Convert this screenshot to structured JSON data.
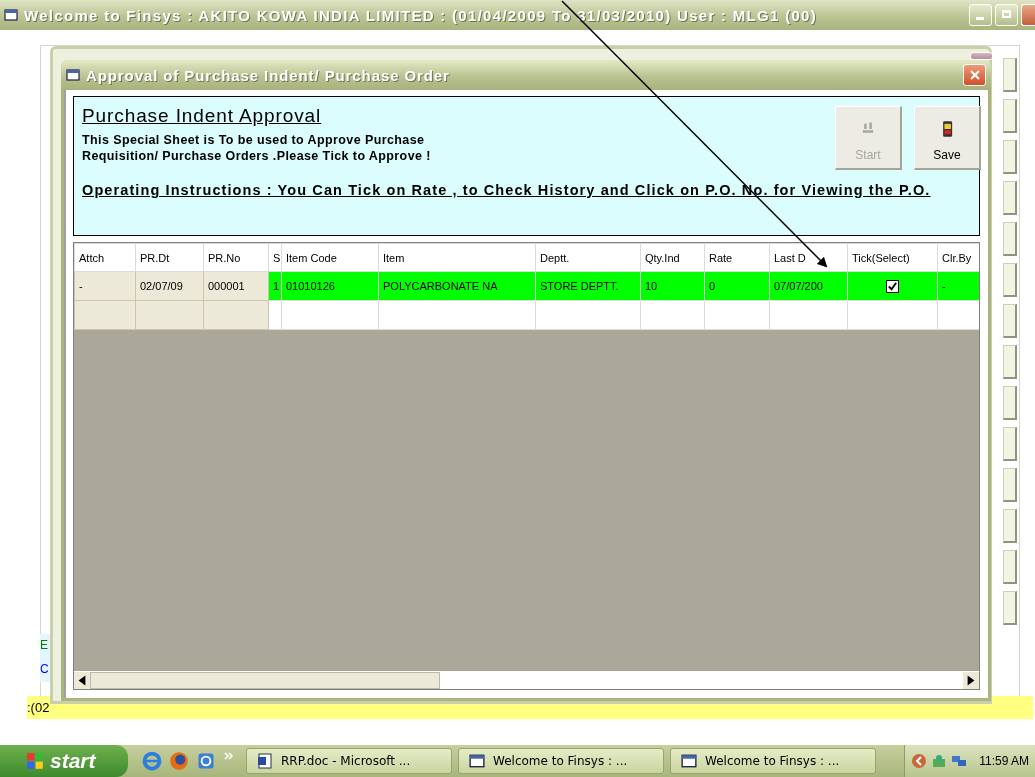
{
  "main_window": {
    "title": "Welcome to Finsys : AKITO KOWA INDIA LIMITED : (01/04/2009 To 31/03/2010) User : MLG1 (00)"
  },
  "background_form": {
    "labels": [
      {
        "text": "E",
        "color": "#008000"
      },
      {
        "text": "C",
        "color": "#0000ff"
      }
    ],
    "status": ":(02"
  },
  "dialog": {
    "title": "Approval of Purchase Indent/ Purchase Order",
    "heading": "Purchase Indent Approval",
    "description": "This Special Sheet is To be used to Approve Purchase Requisition/ Purchase Orders .Please Tick to Approve !",
    "instructions": "Operating Instructions : You Can Tick on Rate , to Check History  and Click on P.O. No. for Viewing the P.O.",
    "toolbar": [
      {
        "kind": "start",
        "label": "Start",
        "disabled": true
      },
      {
        "kind": "save",
        "label": "Save",
        "disabled": false
      }
    ]
  },
  "grid": {
    "columns": [
      {
        "label": "Attch",
        "kind": "fixed"
      },
      {
        "label": "PR.Dt",
        "kind": "fixed"
      },
      {
        "label": "PR.No",
        "kind": "fixed"
      },
      {
        "label": "S",
        "kind": "text"
      },
      {
        "label": "Item Code",
        "kind": "text"
      },
      {
        "label": "Item",
        "kind": "text"
      },
      {
        "label": "Deptt.",
        "kind": "text"
      },
      {
        "label": "Qty.Ind",
        "kind": "text"
      },
      {
        "label": "Rate",
        "kind": "text"
      },
      {
        "label": "Last D",
        "kind": "text"
      },
      {
        "label": "Tick(Select)",
        "kind": "check"
      },
      {
        "label": "Clr.By",
        "kind": "text"
      }
    ],
    "rows": [
      {
        "kind": "record",
        "selected": true,
        "checked": true,
        "cells": [
          "-",
          "02/07/09",
          "000001",
          "1",
          "01010126",
          "POLYCARBONATE NA",
          "STORE DEPTT.",
          "10",
          "0",
          "07/07/200",
          "",
          "-"
        ]
      },
      {
        "kind": "blank"
      }
    ]
  },
  "taskbar": {
    "start": "start",
    "tasks": [
      {
        "kind": "word",
        "label": "RRP.doc - Microsoft ..."
      },
      {
        "kind": "app",
        "label": "Welcome to Finsys : ..."
      },
      {
        "kind": "app",
        "label": "Welcome to Finsys : ..."
      }
    ],
    "clock": "11:59 AM"
  }
}
